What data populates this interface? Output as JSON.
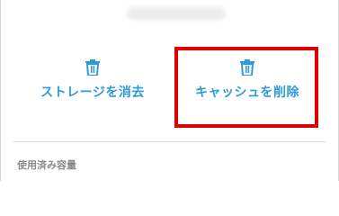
{
  "actions": {
    "clear_storage_label": "ストレージを消去",
    "clear_cache_label": "キャッシュを削除",
    "icon": "trash-icon"
  },
  "usage_section": {
    "title": "使用済み容量"
  },
  "colors": {
    "accent": "#2f9bd6",
    "highlight": "#e00000",
    "section_title": "#8a8a8a",
    "divider": "#dedede"
  }
}
